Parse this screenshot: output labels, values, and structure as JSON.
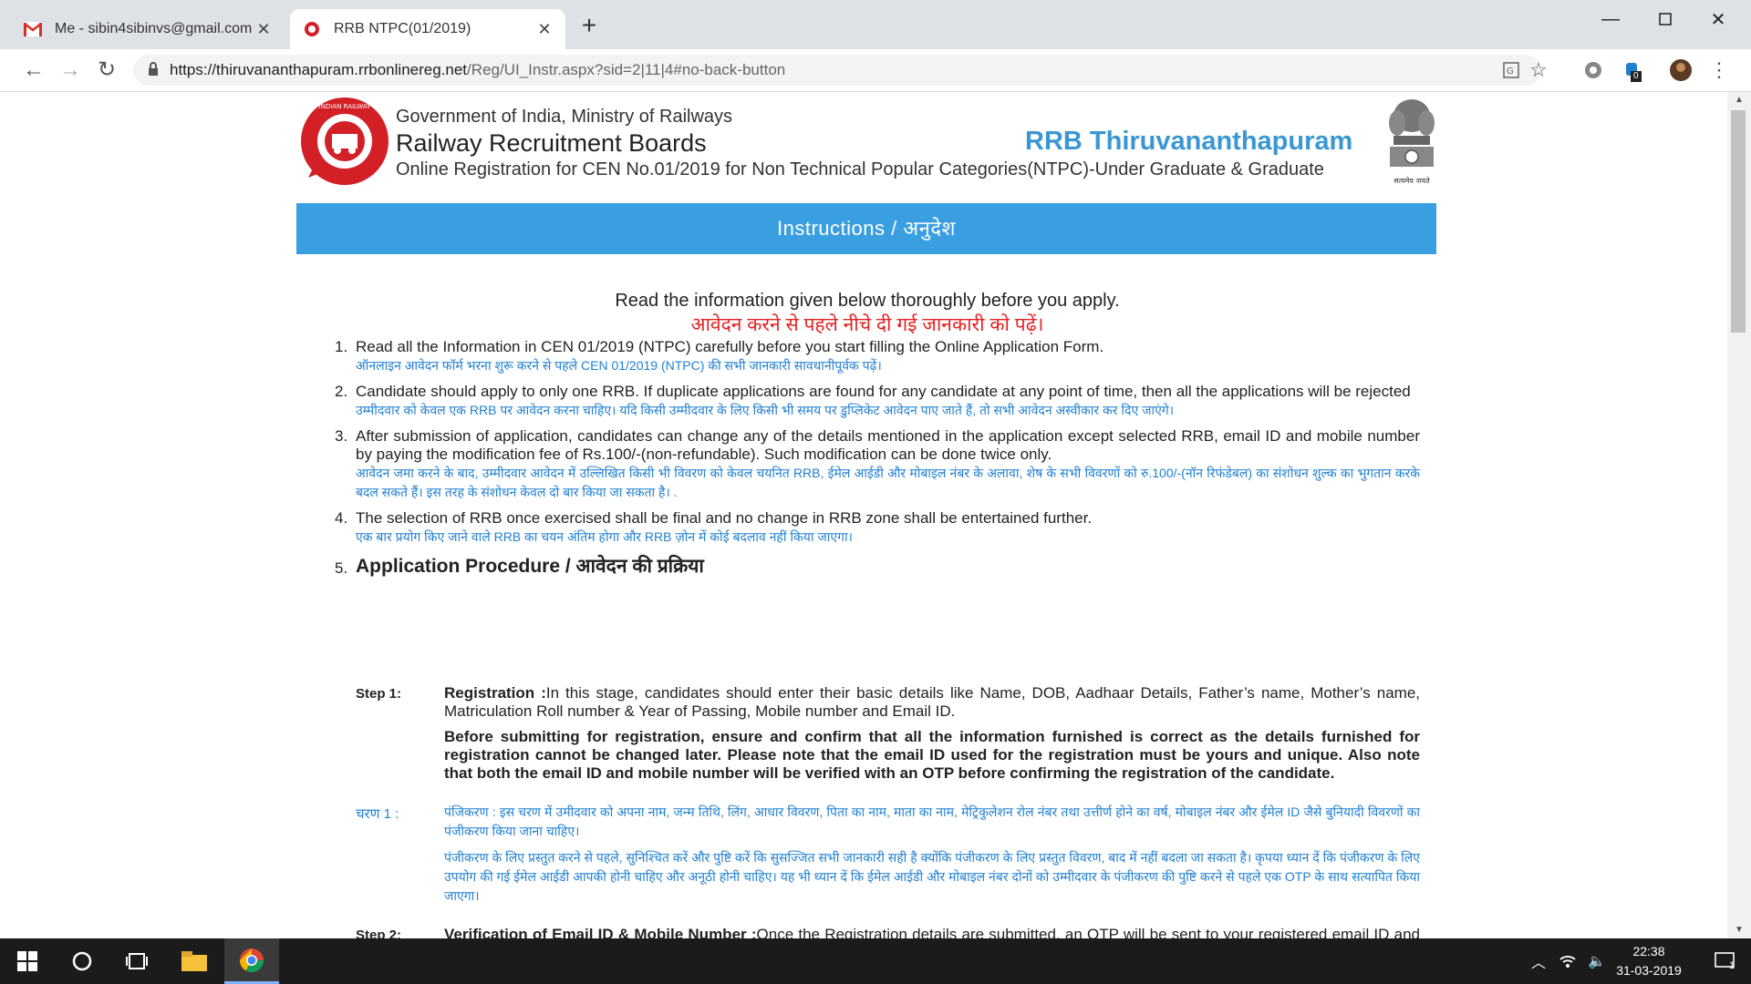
{
  "tabs": [
    {
      "title": "Me - sibin4sibinvs@gmail.com - ",
      "icon": "gmail-icon"
    },
    {
      "title": "RRB NTPC(01/2019)",
      "icon": "rrb-favicon"
    }
  ],
  "address_bar": {
    "url_host": "https://thiruvananthapuram.rrbonlinereg.net",
    "url_path": "/Reg/UI_Instr.aspx?sid=2|11|4#no-back-button"
  },
  "extension_badge": "0",
  "header": {
    "gov_line": "Government of India, Ministry of Railways",
    "org_name": "Railway Recruitment Boards",
    "subtitle": "Online Registration for CEN No.01/2019 for Non Technical Popular Categories(NTPC)-Under Graduate & Graduate",
    "zone": "RRB Thiruvananthapuram",
    "logo_text": "INDIAN RAILWAY",
    "emblem_caption": "सत्यमेव जयते"
  },
  "instructions_title": "Instructions / अनुदेश",
  "intro": {
    "en": "Read the information given below thoroughly before you apply.",
    "hi": "आवेदन करने से पहले नीचे दी गई जानकारी को पढ़ें।"
  },
  "items": [
    {
      "num": "1.",
      "en": "Read all the Information in CEN 01/2019 (NTPC) carefully before you start filling the Online Application Form.",
      "hi": "ऑनलाइन आवेदन फॉर्म भरना शुरू करने से पहले CEN 01/2019 (NTPC) की सभी जानकारी सावधानीपूर्वक पढ़ें।"
    },
    {
      "num": "2.",
      "en": "Candidate should apply to only one RRB. If duplicate applications are found for any candidate at any point of time, then all the applications will be rejected",
      "hi": "उम्मीदवार को केवल एक RRB पर आवेदन करना चाहिए। यदि किसी उम्मीदवार के लिए किसी भी समय पर डुप्लिकेट आवेदन पाए जाते हैं, तो सभी आवेदन अस्वीकार कर दिए जाएंगे।"
    },
    {
      "num": "3.",
      "en": "After submission of application, candidates can change any of the details mentioned in the application except selected RRB, email ID and mobile number by paying the modification fee of Rs.100/-(non-refundable). Such modification can be done twice only.",
      "hi": "आवेदन जमा करने के बाद, उम्मीदवार आवेदन में उल्लिखित किसी भी विवरण को केवल चयनित RRB, ईमेल आईडी और मोबाइल नंबर के अलावा, शेष के सभी विवरणों को रु.100/-(नॉन रिफंडेबल) का संशोधन शुल्क का भुगतान करके बदल सकते हैं। इस तरह के संशोधन केवल दो बार किया जा सकता है। ."
    },
    {
      "num": "4.",
      "en": "The selection of RRB once exercised shall be final and no change in RRB zone shall be entertained further.",
      "hi": "एक बार प्रयोग किए जाने वाले RRB का चयन अंतिम होगा और RRB ज़ोन में कोई बदलाव नहीं किया जाएगा।"
    },
    {
      "num": "5.",
      "en": "Application Procedure / आवेदन की प्रक्रिया",
      "hi": ""
    }
  ],
  "steps": {
    "step1_label": "Step 1:",
    "step1_title": "Registration :",
    "step1_text": "In this stage, candidates should enter their basic details like Name, DOB, Aadhaar Details, Father’s name, Mother’s name, Matriculation Roll number & Year of Passing, Mobile number and Email ID.",
    "step1_bold": "Before submitting for registration, ensure and confirm that all the information furnished is correct as the details furnished for registration cannot be changed later. Please note that the email ID used for the registration must be yours and unique. Also note that both the email ID and mobile number will be verified with an OTP before confirming the registration of the candidate.",
    "charan1_label": "चरण 1 :",
    "charan1_p1": "पंजिकरण : इस चरण में उमीदवार को अपना नाम, जन्म तिथि, लिंग, आधार विवरण, पिता का नाम, माता का नाम, मेट्रिकुलेशन रोल नंबर तथा उत्तीर्ण होने का वर्ष, मोबाइल नंबर और ईमेल ID जैसे बुनियादी विवरणों का पंजीकरण किया जाना चाहिए।",
    "charan1_p2": "पंजीकरण के लिए प्रस्तुत करने से पहले, सुनिश्चित करें और पुष्टि करें कि सुसज्जित सभी जानकारी सही है क्योंकि पंजीकरण के लिए प्रस्तुत विवरण, बाद में नहीं बदला जा सकता है। कृपया ध्यान दें कि पंजीकरण के लिए उपयोग की गई ईमेल आईडी आपकी होनी चाहिए और अनूठी होनी चाहिए। यह भी ध्यान दें कि ईमेल आईडी और मोबाइल नंबर दोनों को उम्मीदवार के पंजीकरण की पुष्टि करने से पहले एक OTP के साथ सत्यापित किया जाएगा।",
    "step2_label": "Step 2:",
    "step2_title": "Verification of Email ID & Mobile Number :",
    "step2_text": "Once the Registration details are submitted, an OTP will be sent to your registered email ID and another OTP to your registered mobile number. Click on the “Verify through OTP” link on the Home page of the online registration portal and enter the OTP received on your email and mobile in the respective fields. After validation of both the OTPs, the Registration"
  },
  "taskbar": {
    "time": "22:38",
    "date": "31-03-2019",
    "notification_count": "1"
  },
  "colors": {
    "accent_blue": "#3a9fe0",
    "zone_blue": "#3a97d4",
    "hindi_blue": "#1f7fd1",
    "hindi_red": "#e52020"
  }
}
